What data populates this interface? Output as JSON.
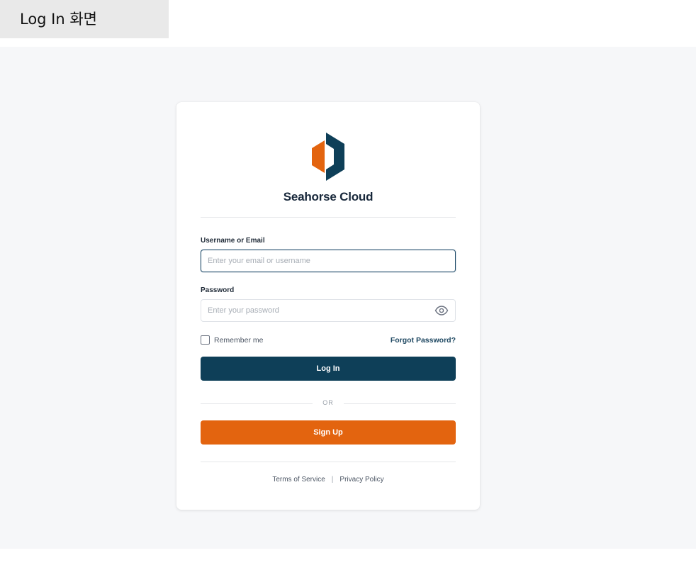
{
  "tab": {
    "label": "Log In 화면"
  },
  "brand": {
    "name": "Seahorse Cloud",
    "colors": {
      "primary": "#0e3f58",
      "accent": "#e3640f"
    },
    "logo_icon": "hexagon-d-logo-icon"
  },
  "form": {
    "username": {
      "label": "Username or Email",
      "placeholder": "Enter your email or username",
      "value": ""
    },
    "password": {
      "label": "Password",
      "placeholder": "Enter your password",
      "value": "",
      "toggle_icon": "eye-icon"
    },
    "remember_label": "Remember me",
    "remember_checked": false,
    "forgot_label": "Forgot Password?",
    "login_label": "Log In",
    "or_label": "OR",
    "signup_label": "Sign Up"
  },
  "footer": {
    "terms": "Terms of Service",
    "separator": "|",
    "privacy": "Privacy Policy"
  }
}
